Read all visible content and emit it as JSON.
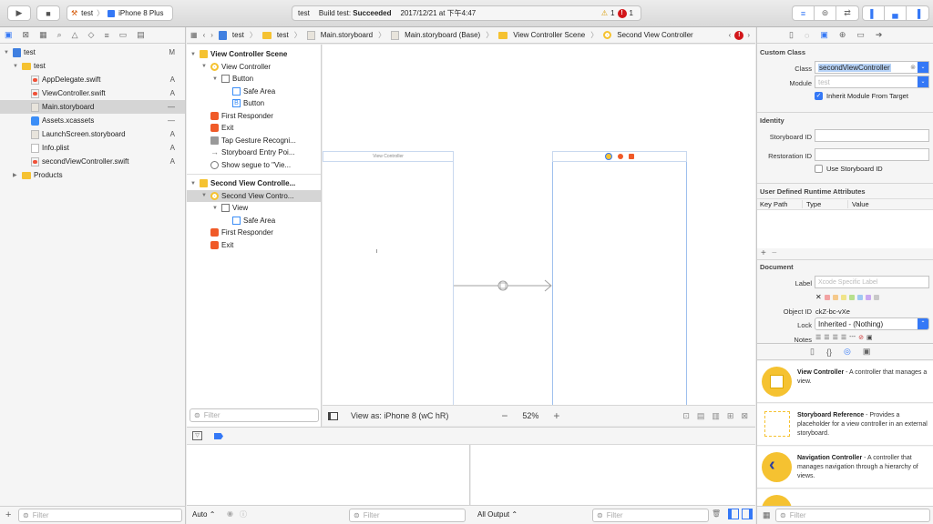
{
  "toolbar": {
    "scheme_target": "test",
    "device": "iPhone 8 Plus",
    "status_project": "test",
    "status_build_prefix": "Build test: ",
    "status_build_result": "Succeeded",
    "status_time": "2017/12/21 at 下午4:47",
    "warnings": "1",
    "errors": "1"
  },
  "navigator": {
    "items": [
      {
        "label": "test",
        "status": "M"
      },
      {
        "label": "test",
        "status": ""
      },
      {
        "label": "AppDelegate.swift",
        "status": "A"
      },
      {
        "label": "ViewController.swift",
        "status": "A"
      },
      {
        "label": "Main.storyboard",
        "status": "—"
      },
      {
        "label": "Assets.xcassets",
        "status": "—"
      },
      {
        "label": "LaunchScreen.storyboard",
        "status": "A"
      },
      {
        "label": "Info.plist",
        "status": "A"
      },
      {
        "label": "secondViewController.swift",
        "status": "A"
      },
      {
        "label": "Products",
        "status": ""
      }
    ],
    "filter_placeholder": "Filter"
  },
  "jumpbar": {
    "crumbs": [
      "test",
      "test",
      "Main.storyboard",
      "Main.storyboard (Base)",
      "View Controller Scene",
      "Second View Controller"
    ]
  },
  "outline": {
    "items": [
      {
        "label": "View Controller Scene"
      },
      {
        "label": "View Controller"
      },
      {
        "label": "Button"
      },
      {
        "label": "Safe Area"
      },
      {
        "label": "Button"
      },
      {
        "label": "First Responder"
      },
      {
        "label": "Exit"
      },
      {
        "label": "Tap Gesture Recogni..."
      },
      {
        "label": "Storyboard Entry Poi..."
      },
      {
        "label": "Show segue to \"Vie..."
      },
      {
        "label": "Second View Controlle..."
      },
      {
        "label": "Second View Contro..."
      },
      {
        "label": "View"
      },
      {
        "label": "Safe Area"
      },
      {
        "label": "First Responder"
      },
      {
        "label": "Exit"
      }
    ],
    "filter_placeholder": "Filter"
  },
  "canvas": {
    "vc1_title": "View Controller",
    "view_as": "View as: iPhone 8 (wC hR)",
    "zoom": "52%"
  },
  "debug": {
    "auto_label": "Auto",
    "all_output_label": "All Output",
    "filter_placeholder": "Filter"
  },
  "inspector": {
    "custom_class_header": "Custom Class",
    "class_label": "Class",
    "class_value": "secondViewController",
    "module_label": "Module",
    "module_placeholder": "test",
    "inherit_label": "Inherit Module From Target",
    "identity_header": "Identity",
    "storyboard_id_label": "Storyboard ID",
    "restoration_id_label": "Restoration ID",
    "use_storyboard_id_label": "Use Storyboard ID",
    "runtime_header": "User Defined Runtime Attributes",
    "col_keypath": "Key Path",
    "col_type": "Type",
    "col_value": "Value",
    "document_header": "Document",
    "doc_label_label": "Label",
    "doc_label_placeholder": "Xcode Specific Label",
    "object_id_label": "Object ID",
    "object_id_value": "ckZ-bc-vXe",
    "lock_label": "Lock",
    "lock_value": "Inherited - (Nothing)",
    "notes_label": "Notes",
    "swatch_colors": [
      "#f2a3a3",
      "#f5c98b",
      "#f0e48a",
      "#b7e08d",
      "#9fc8f2",
      "#c9a9f0",
      "#c8c8c8"
    ],
    "filter_placeholder": "Filter"
  },
  "library": {
    "items": [
      {
        "title": "View Controller",
        "desc": " - A controller that manages a view."
      },
      {
        "title": "Storyboard Reference",
        "desc": " - Provides a placeholder for a view controller in an external storyboard."
      },
      {
        "title": "Navigation Controller",
        "desc": " - A controller that manages navigation through a hierarchy of views."
      }
    ]
  }
}
